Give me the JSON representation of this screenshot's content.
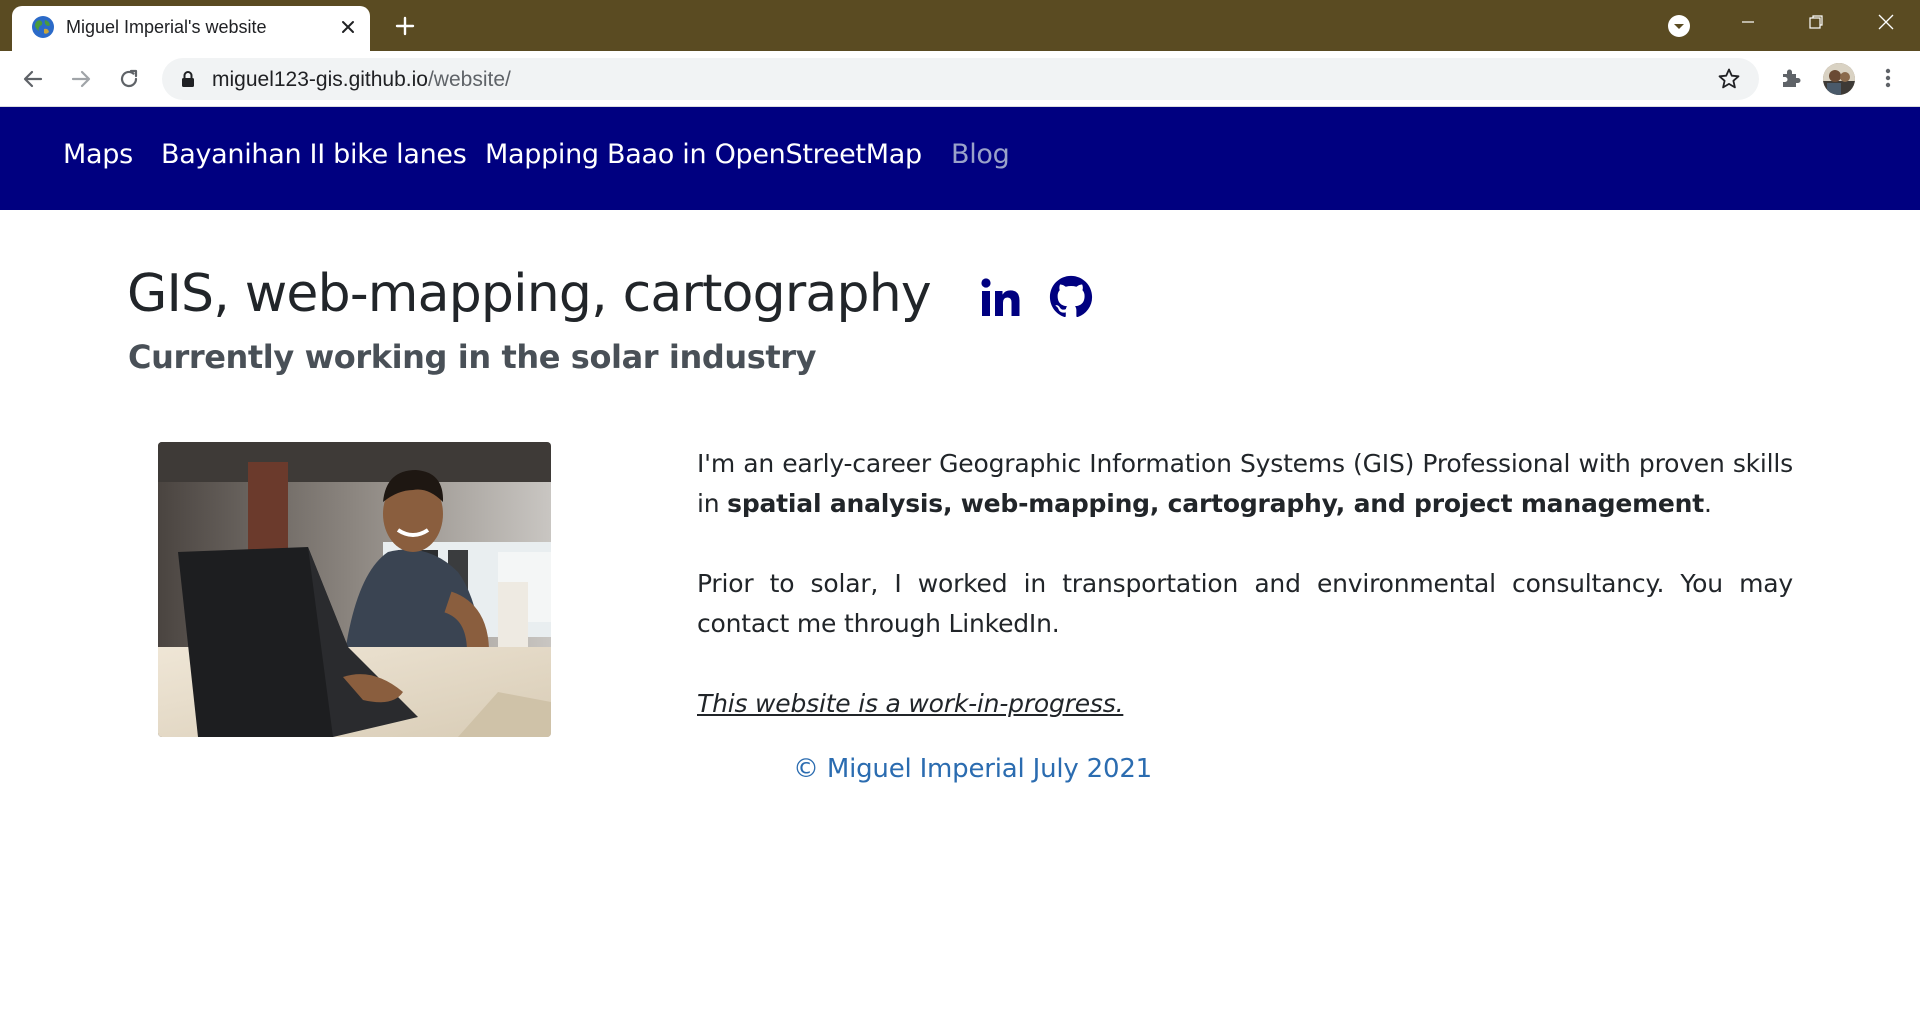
{
  "browser": {
    "tab_title": "Miguel Imperial's website",
    "url_host": "miguel123-gis.github.io",
    "url_path": "/website/",
    "colors": {
      "frame": "#5a4b22",
      "toolbar": "#ffffff",
      "omnibox": "#f1f3f4"
    }
  },
  "site": {
    "nav": {
      "items": [
        {
          "label": "Maps"
        },
        {
          "label": "Bayanihan II bike lanes"
        },
        {
          "label": "Mapping Baao in OpenStreetMap"
        },
        {
          "label": "Blog"
        }
      ],
      "background": "#000080"
    },
    "hero": {
      "title": "GIS, web-mapping, cartography",
      "subtitle": "Currently working in the solar industry",
      "social": [
        {
          "icon": "linkedin-icon"
        },
        {
          "icon": "github-icon"
        }
      ]
    },
    "bio": {
      "p1_text": "I'm an early-career Geographic Information Systems (GIS) Professional with proven skills in ",
      "p1_bold": "spatial analysis, web-mapping, cartography, and project management",
      "p1_end": ".",
      "p2": "Prior to solar, I worked in transportation and environmental consultancy. You may contact me through LinkedIn.",
      "p3": "This website is a work-in-progress."
    },
    "footer": "© Miguel Imperial July 2021"
  }
}
